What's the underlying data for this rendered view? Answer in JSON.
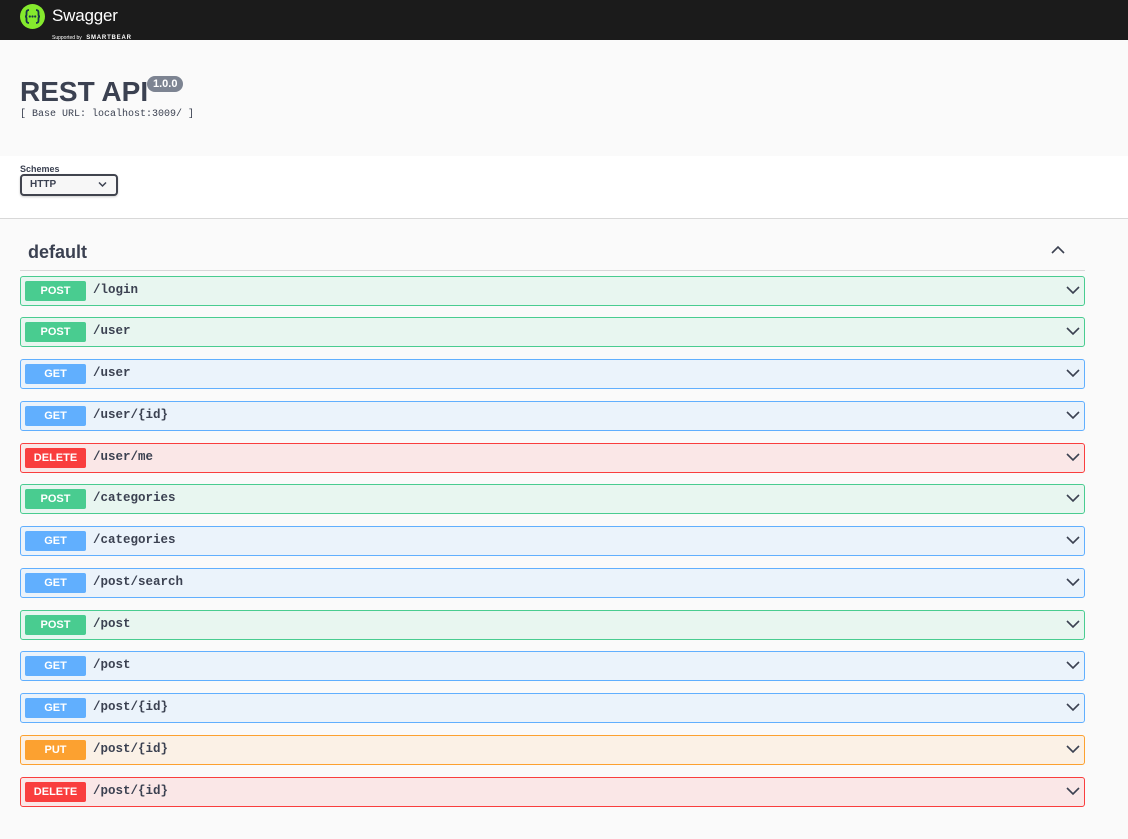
{
  "topbar": {
    "brand": "Swagger",
    "supported_by": "Supported by",
    "company": "SMARTBEAR"
  },
  "info": {
    "title": "REST API",
    "version": "1.0.0",
    "base_url": "[ Base URL: localhost:3009/ ]"
  },
  "schemes": {
    "label": "Schemes",
    "selected": "HTTP"
  },
  "section": {
    "title": "default"
  },
  "operations": [
    {
      "method": "POST",
      "path": "/login"
    },
    {
      "method": "POST",
      "path": "/user"
    },
    {
      "method": "GET",
      "path": "/user"
    },
    {
      "method": "GET",
      "path": "/user/{id}"
    },
    {
      "method": "DELETE",
      "path": "/user/me"
    },
    {
      "method": "POST",
      "path": "/categories"
    },
    {
      "method": "GET",
      "path": "/categories"
    },
    {
      "method": "GET",
      "path": "/post/search"
    },
    {
      "method": "POST",
      "path": "/post"
    },
    {
      "method": "GET",
      "path": "/post"
    },
    {
      "method": "GET",
      "path": "/post/{id}"
    },
    {
      "method": "PUT",
      "path": "/post/{id}"
    },
    {
      "method": "DELETE",
      "path": "/post/{id}"
    }
  ],
  "colors": {
    "topbar": "#1b1b1b",
    "logo_green": "#85ea2d",
    "post": "#49cc90",
    "get": "#61affe",
    "delete": "#f93e3e",
    "put": "#fca130"
  }
}
